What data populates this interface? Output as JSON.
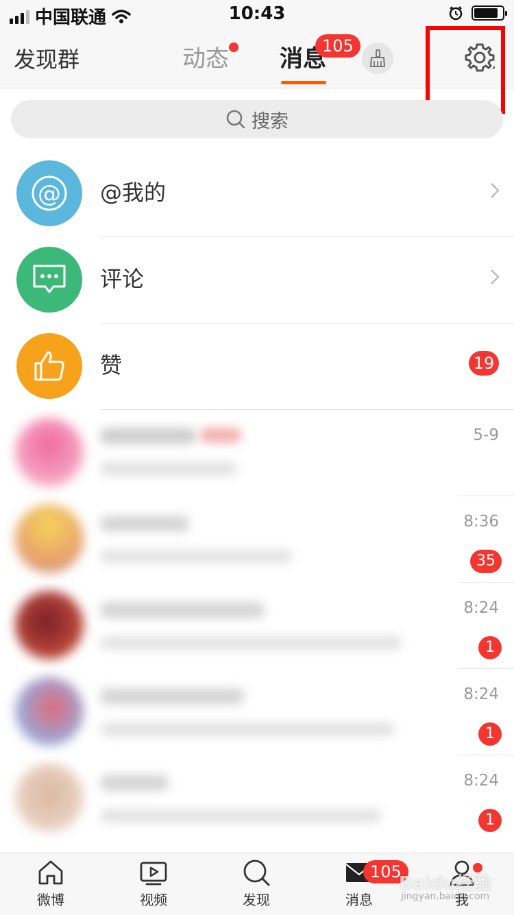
{
  "status_bar": {
    "carrier": "中国联通",
    "time": "10:43"
  },
  "header": {
    "left_title": "发现群",
    "tabs": [
      {
        "label": "动态",
        "has_dot": true
      },
      {
        "label": "消息",
        "badge": "105",
        "active": true
      }
    ],
    "icons": [
      "broom-icon",
      "gear-icon"
    ]
  },
  "search": {
    "placeholder": "搜索"
  },
  "categories": [
    {
      "label": "@我的",
      "icon": "at-icon",
      "color": "#5bb7dc"
    },
    {
      "label": "评论",
      "icon": "comment-icon",
      "color": "#3cb879"
    },
    {
      "label": "赞",
      "icon": "thumbs-up-icon",
      "color": "#f7a21b",
      "badge": "19"
    }
  ],
  "conversations": [
    {
      "time": "5-9"
    },
    {
      "time": "8:36",
      "badge": "35"
    },
    {
      "time": "8:24",
      "badge": "1"
    },
    {
      "time": "8:24",
      "badge": "1"
    },
    {
      "time": "8:24",
      "badge": "1"
    }
  ],
  "tabbar": {
    "items": [
      {
        "label": "微博",
        "icon": "home-icon"
      },
      {
        "label": "视频",
        "icon": "video-icon"
      },
      {
        "label": "发现",
        "icon": "search-icon"
      },
      {
        "label": "消息",
        "icon": "mail-icon",
        "badge": "105"
      },
      {
        "label": "我",
        "icon": "profile-icon",
        "has_dot": true
      }
    ]
  },
  "watermark": {
    "text": "Baidu经验",
    "sub": "jingyan.baidu.com"
  },
  "colors": {
    "accent": "#ff5a00",
    "badge_red": "#f43530",
    "highlight_box": "#ff0000"
  }
}
